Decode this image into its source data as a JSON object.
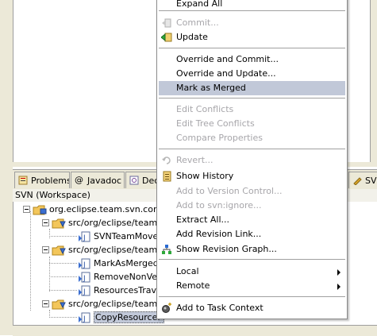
{
  "context_menu": {
    "items": [
      {
        "label": "Expand All",
        "enabled": true
      },
      {
        "label": "Commit...",
        "enabled": false,
        "icon": "commit-icon"
      },
      {
        "label": "Update",
        "enabled": true,
        "icon": "update-icon"
      },
      {
        "label": "Override and Commit...",
        "enabled": true
      },
      {
        "label": "Override and Update...",
        "enabled": true
      },
      {
        "label": "Mark as Merged",
        "enabled": true,
        "highlighted": true
      },
      {
        "label": "Edit Conflicts",
        "enabled": false
      },
      {
        "label": "Edit Tree Conflicts",
        "enabled": false
      },
      {
        "label": "Compare Properties",
        "enabled": false
      },
      {
        "label": "Revert...",
        "enabled": false,
        "icon": "revert-icon"
      },
      {
        "label": "Show History",
        "enabled": true,
        "icon": "history-icon"
      },
      {
        "label": "Add to Version Control...",
        "enabled": false
      },
      {
        "label": "Add to svn:ignore...",
        "enabled": false
      },
      {
        "label": "Extract All...",
        "enabled": true
      },
      {
        "label": "Add Revision Link...",
        "enabled": true
      },
      {
        "label": "Show Revision Graph...",
        "enabled": true,
        "icon": "revision-graph-icon"
      },
      {
        "label": "Local",
        "enabled": true,
        "submenu": true
      },
      {
        "label": "Remote",
        "enabled": true,
        "submenu": true
      },
      {
        "label": "Add to Task Context",
        "enabled": true,
        "icon": "task-context-icon"
      }
    ]
  },
  "view_tabs": [
    {
      "label": "Problems",
      "icon": "problems-icon"
    },
    {
      "label": "Javadoc",
      "icon": "javadoc-icon"
    },
    {
      "label": "Dec",
      "icon": "declaration-icon"
    },
    {
      "label": "SVN P",
      "icon": "svn-icon"
    }
  ],
  "svn_view": {
    "title": "SVN (Workspace)"
  },
  "tree": {
    "project": "org.eclipse.team.svn.core",
    "folders": [
      {
        "label": "src/org/eclipse/team",
        "files": [
          "SVNTeamMoveD"
        ]
      },
      {
        "label": "src/org/eclipse/team",
        "files": [
          "MarkAsMergedO",
          "RemoveNonVer",
          "ResourcesTrave"
        ]
      },
      {
        "label": "src/org/eclipse/team",
        "files": [
          "CopyResourceF"
        ]
      }
    ]
  },
  "colors": {
    "menu_highlight": "#c1c8d8",
    "disabled_text": "#a7a6aa",
    "chrome": "#ece9d8"
  }
}
